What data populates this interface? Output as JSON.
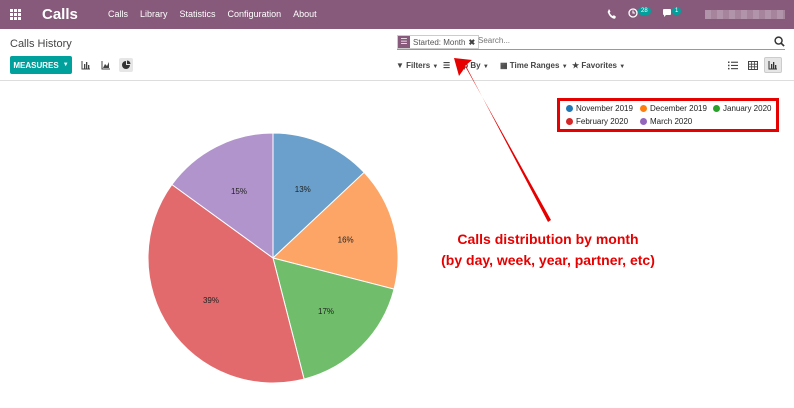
{
  "app": {
    "name": "Calls",
    "menu": [
      "Calls",
      "Library",
      "Statistics",
      "Configuration",
      "About"
    ],
    "activities_count": "28",
    "messages_count": "1"
  },
  "page": {
    "title": "Calls History"
  },
  "search": {
    "facet_label": "Started: Month",
    "placeholder": "Search..."
  },
  "toolbar": {
    "measures_label": "MEASURES",
    "filters_label": "Filters",
    "groupby_label": "Group By",
    "groupby_visible": "up By",
    "timeranges_label": "Time Ranges",
    "favorites_label": "Favorites"
  },
  "annotation": {
    "line1": "Calls distribution by month",
    "line2": "(by day, week, year, partner, etc)"
  },
  "colors": {
    "brand": "#875a7b",
    "accent": "#00a09d",
    "annotation": "#e60000"
  },
  "chart_data": {
    "type": "pie",
    "categories": [
      "November 2019",
      "December 2019",
      "January 2020",
      "February 2020",
      "March 2020"
    ],
    "values": [
      13,
      16,
      17,
      39,
      15
    ],
    "labels": [
      "13%",
      "16%",
      "17%",
      "39%",
      "15%"
    ],
    "legend_colors": [
      "#1f77b4",
      "#ff7f0e",
      "#2ca02c",
      "#d62728",
      "#9467bd"
    ],
    "slice_colors": [
      "#6aa0cb",
      "#fca566",
      "#70bd6b",
      "#e26a6c",
      "#b194cc"
    ],
    "legend_position": "top-right"
  }
}
